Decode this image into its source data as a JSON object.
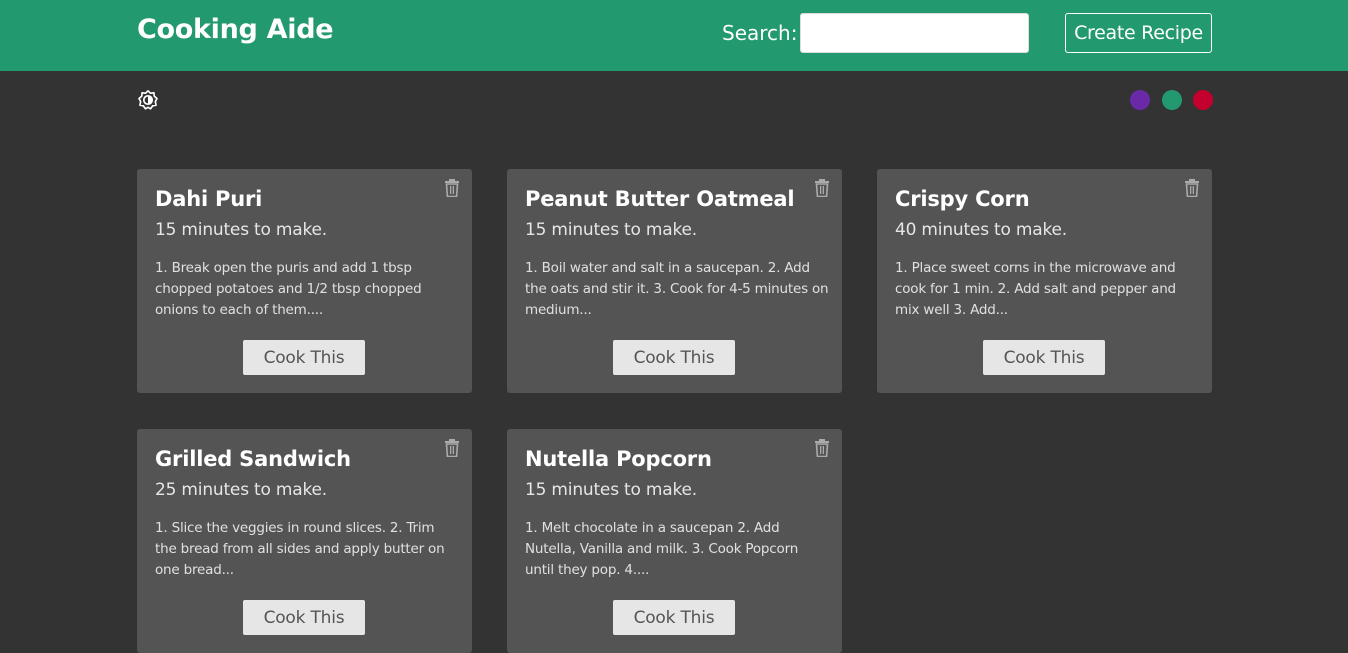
{
  "header": {
    "brand": "Cooking Aide",
    "search_label": "Search:",
    "search_value": "",
    "create_label": "Create Recipe"
  },
  "toolbar": {
    "theme_icon": "contrast-icon",
    "color_swatches": [
      {
        "name": "purple",
        "color": "#6a2aa8"
      },
      {
        "name": "green",
        "color": "#22996e"
      },
      {
        "name": "red",
        "color": "#c4002e"
      }
    ]
  },
  "recipes": [
    {
      "title": "Dahi Puri",
      "time": "15 minutes to make.",
      "description": "1. Break open the puris and add 1 tbsp chopped potatoes and 1/2 tbsp chopped onions to each of them....",
      "button": "Cook This"
    },
    {
      "title": "Peanut Butter Oatmeal",
      "time": "15 minutes to make.",
      "description": "1. Boil water and salt in a saucepan. 2. Add the oats and stir it. 3. Cook for 4-5 minutes on medium...",
      "button": "Cook This"
    },
    {
      "title": "Crispy Corn",
      "time": "40 minutes to make.",
      "description": "1. Place sweet corns in the microwave and cook for 1 min. 2. Add salt and pepper and mix well 3. Add...",
      "button": "Cook This"
    },
    {
      "title": "Grilled Sandwich",
      "time": "25 minutes to make.",
      "description": "1. Slice the veggies in round slices. 2. Trim the bread from all sides and apply butter on one bread...",
      "button": "Cook This"
    },
    {
      "title": "Nutella Popcorn",
      "time": "15 minutes to make.",
      "description": "1. Melt chocolate in a saucepan 2. Add Nutella, Vanilla and milk. 3. Cook Popcorn until they pop. 4....",
      "button": "Cook This"
    }
  ]
}
